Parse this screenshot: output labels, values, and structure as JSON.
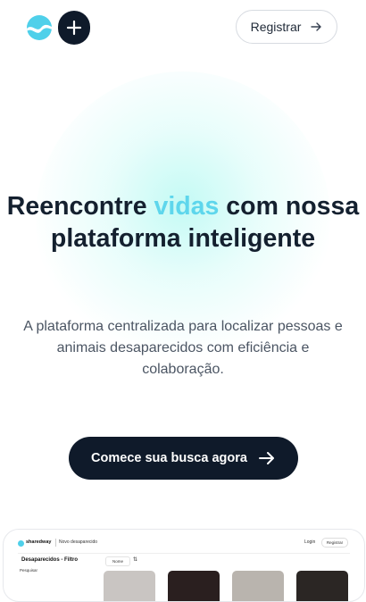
{
  "header": {
    "logo_name": "logo-icon",
    "add_icon": "plus-icon",
    "register_label": "Registrar",
    "register_icon": "arrow-right-icon"
  },
  "hero": {
    "title_part1": "Reencontre ",
    "title_accent": "vidas",
    "title_part2": " com nossa plataforma inteligente",
    "accent_color": "#5ed6ec",
    "subtitle": "A plataforma centralizada para localizar pessoas e animais desaparecidos com eficiência e colaboração.",
    "cta_label": "Comece sua busca agora",
    "cta_icon": "arrow-right-icon"
  },
  "preview": {
    "brand": "sharedway",
    "new_missing": "Novo desaparecido",
    "login": "Login",
    "register": "Registrar",
    "page_title": "Desaparecidos - Filtro",
    "search_label": "Pesquisar",
    "filter_label": "Nome",
    "sort_icon": "sort-icon"
  },
  "colors": {
    "dark": "#0f1a2a",
    "brand_cyan": "#4fd0ea"
  }
}
